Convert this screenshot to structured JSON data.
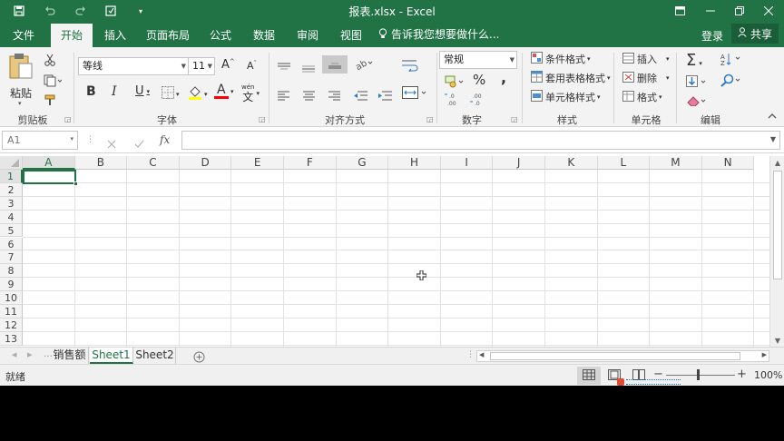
{
  "window": {
    "title": "报表.xlsx - Excel",
    "quick_access": [
      "save-icon",
      "undo-icon",
      "redo-icon",
      "touch-mode-icon",
      "customize-icon"
    ],
    "controls": [
      "ribbon-display-icon",
      "minimize-icon",
      "restore-icon",
      "close-icon"
    ]
  },
  "ribbon_tabs": [
    "文件",
    "开始",
    "插入",
    "页面布局",
    "公式",
    "数据",
    "审阅",
    "视图"
  ],
  "active_tab": "开始",
  "tell_me": "告诉我您想要做什么...",
  "login": "登录",
  "share": "共享",
  "clipboard": {
    "paste": "粘贴",
    "label": "剪贴板"
  },
  "font": {
    "name": "等线",
    "size": "11",
    "label": "字体",
    "bold": "B",
    "italic": "I",
    "underline": "U",
    "grow": "A",
    "shrink": "A",
    "font_color": "A",
    "phonetic": "wén"
  },
  "alignment": {
    "label": "对齐方式"
  },
  "number": {
    "format": "常规",
    "label": "数字",
    "percent": "%",
    "comma": ","
  },
  "styles": {
    "conditional": "条件格式",
    "table": "套用表格格式",
    "cell_styles": "单元格样式",
    "label": "样式"
  },
  "cells": {
    "insert": "插入",
    "delete": "删除",
    "format": "格式",
    "label": "单元格"
  },
  "editing": {
    "label": "编辑"
  },
  "formula_bar": {
    "name_box": "A1",
    "fx": "fx",
    "value": ""
  },
  "columns": [
    "A",
    "B",
    "C",
    "D",
    "E",
    "F",
    "G",
    "H",
    "I",
    "J",
    "K",
    "L",
    "M",
    "N"
  ],
  "rows": [
    "1",
    "2",
    "3",
    "4",
    "5",
    "6",
    "7",
    "8",
    "9",
    "10",
    "11",
    "12",
    "13"
  ],
  "selected_cell": "A1",
  "sheets": [
    "销售额",
    "Sheet1",
    "Sheet2"
  ],
  "active_sheet": "Sheet1",
  "status": {
    "ready": "就绪",
    "zoom": "100%"
  },
  "colors": {
    "brand": "#217346",
    "font_color_bar": "#ff0000",
    "highlight_bar": "#ffff00"
  }
}
